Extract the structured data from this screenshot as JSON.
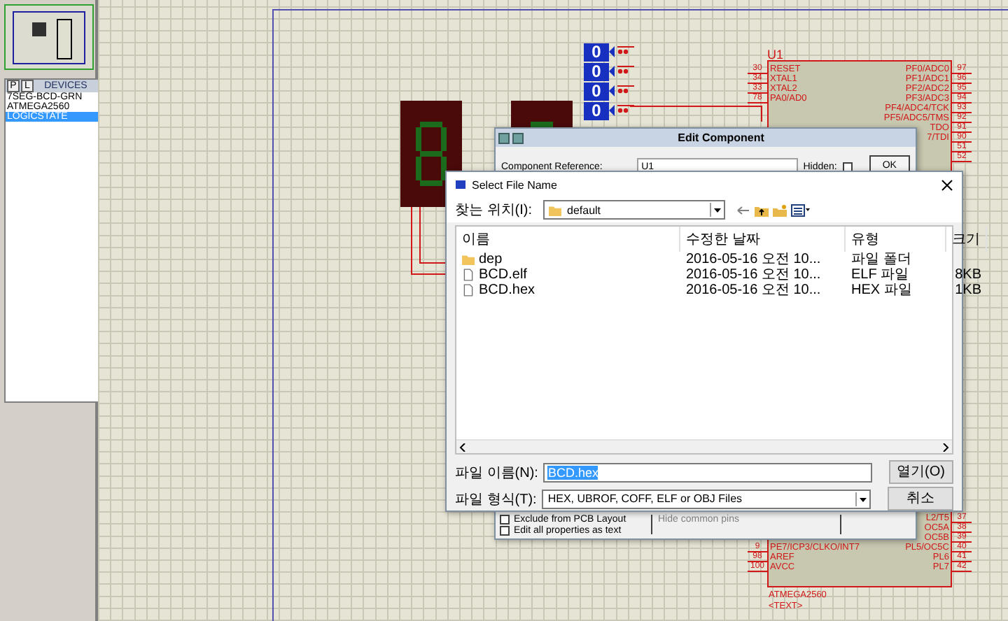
{
  "sidebar": {
    "mode_buttons": [
      {
        "label": "P",
        "selected": false
      },
      {
        "label": "L",
        "selected": false
      }
    ],
    "title": "DEVICES",
    "devices": [
      {
        "label": "7SEG-BCD-GRN",
        "selected": false
      },
      {
        "label": "ATMEGA2560",
        "selected": false
      },
      {
        "label": "LOGICSTATE",
        "selected": true
      }
    ]
  },
  "schematic": {
    "logic_states": [
      "0",
      "0",
      "0",
      "0"
    ],
    "chip": {
      "reference": "U1",
      "part": "ATMEGA2560",
      "text": "<TEXT>",
      "pins_top_left": [
        {
          "num": "30",
          "name": "RESET"
        },
        {
          "num": "34",
          "name": "XTAL1"
        },
        {
          "num": "33",
          "name": "XTAL2"
        },
        {
          "num": "78",
          "name": "PA0/AD0"
        }
      ],
      "pins_top_right": [
        {
          "num": "97",
          "name": "PF0/ADC0"
        },
        {
          "num": "96",
          "name": "PF1/ADC1"
        },
        {
          "num": "95",
          "name": "PF2/ADC2"
        },
        {
          "num": "94",
          "name": "PF3/ADC3"
        },
        {
          "num": "93",
          "name": "PF4/ADC4/TCK"
        },
        {
          "num": "92",
          "name": "PF5/ADC5/TMS"
        },
        {
          "num": "91",
          "name": "TDO"
        },
        {
          "num": "90",
          "name": "7/TDI"
        },
        {
          "num": "51"
        },
        {
          "num": "52"
        }
      ],
      "pins_bottom_left": [
        {
          "num": "9",
          "name": "PE7/ICP3/CLKO/INT7"
        },
        {
          "num": "98",
          "name": "AREF"
        },
        {
          "num": "100",
          "name": "AVCC"
        }
      ],
      "pins_bottom_right": [
        {
          "num": "37",
          "name": "L2/T5"
        },
        {
          "num": "38",
          "name": "OC5A"
        },
        {
          "num": "39",
          "name": "OC5B"
        },
        {
          "num": "40",
          "name": "PL5/OC5C"
        },
        {
          "num": "41",
          "name": "PL6"
        },
        {
          "num": "42",
          "name": "PL7"
        }
      ]
    }
  },
  "edit_component": {
    "title": "Edit Component",
    "reference_label": "Component Reference:",
    "reference_value": "U1",
    "hidden_label": "Hidden:",
    "hidden_checked": false,
    "ok": "OK",
    "hide_pins_label": "Hide common pins",
    "options": [
      {
        "label": "Exclude from PCB Layout",
        "checked": false
      },
      {
        "label": "Edit all properties as text",
        "checked": false
      }
    ]
  },
  "file_dialog": {
    "title": "Select File Name",
    "location_label": "찾는 위치(I):",
    "location": "default",
    "columns": [
      "이름",
      "수정한 날짜",
      "유형",
      "크기"
    ],
    "files": [
      {
        "kind": "folder",
        "name": "dep",
        "modified": "2016-05-16 오전 10...",
        "type": "파일 폴더"
      },
      {
        "kind": "file",
        "name": "BCD.elf",
        "modified": "2016-05-16 오전 10...",
        "type": "ELF 파일",
        "size": "8KB"
      },
      {
        "kind": "file",
        "name": "BCD.hex",
        "modified": "2016-05-16 오전 10...",
        "type": "HEX 파일",
        "size": "1KB"
      }
    ],
    "filename_label": "파일 이름(N):",
    "filename": "BCD.hex",
    "filetype_label": "파일 형식(T):",
    "filetype": "HEX, UBROF, COFF, ELF or OBJ Files",
    "open_button": "열기(O)",
    "cancel_button": "취소"
  }
}
